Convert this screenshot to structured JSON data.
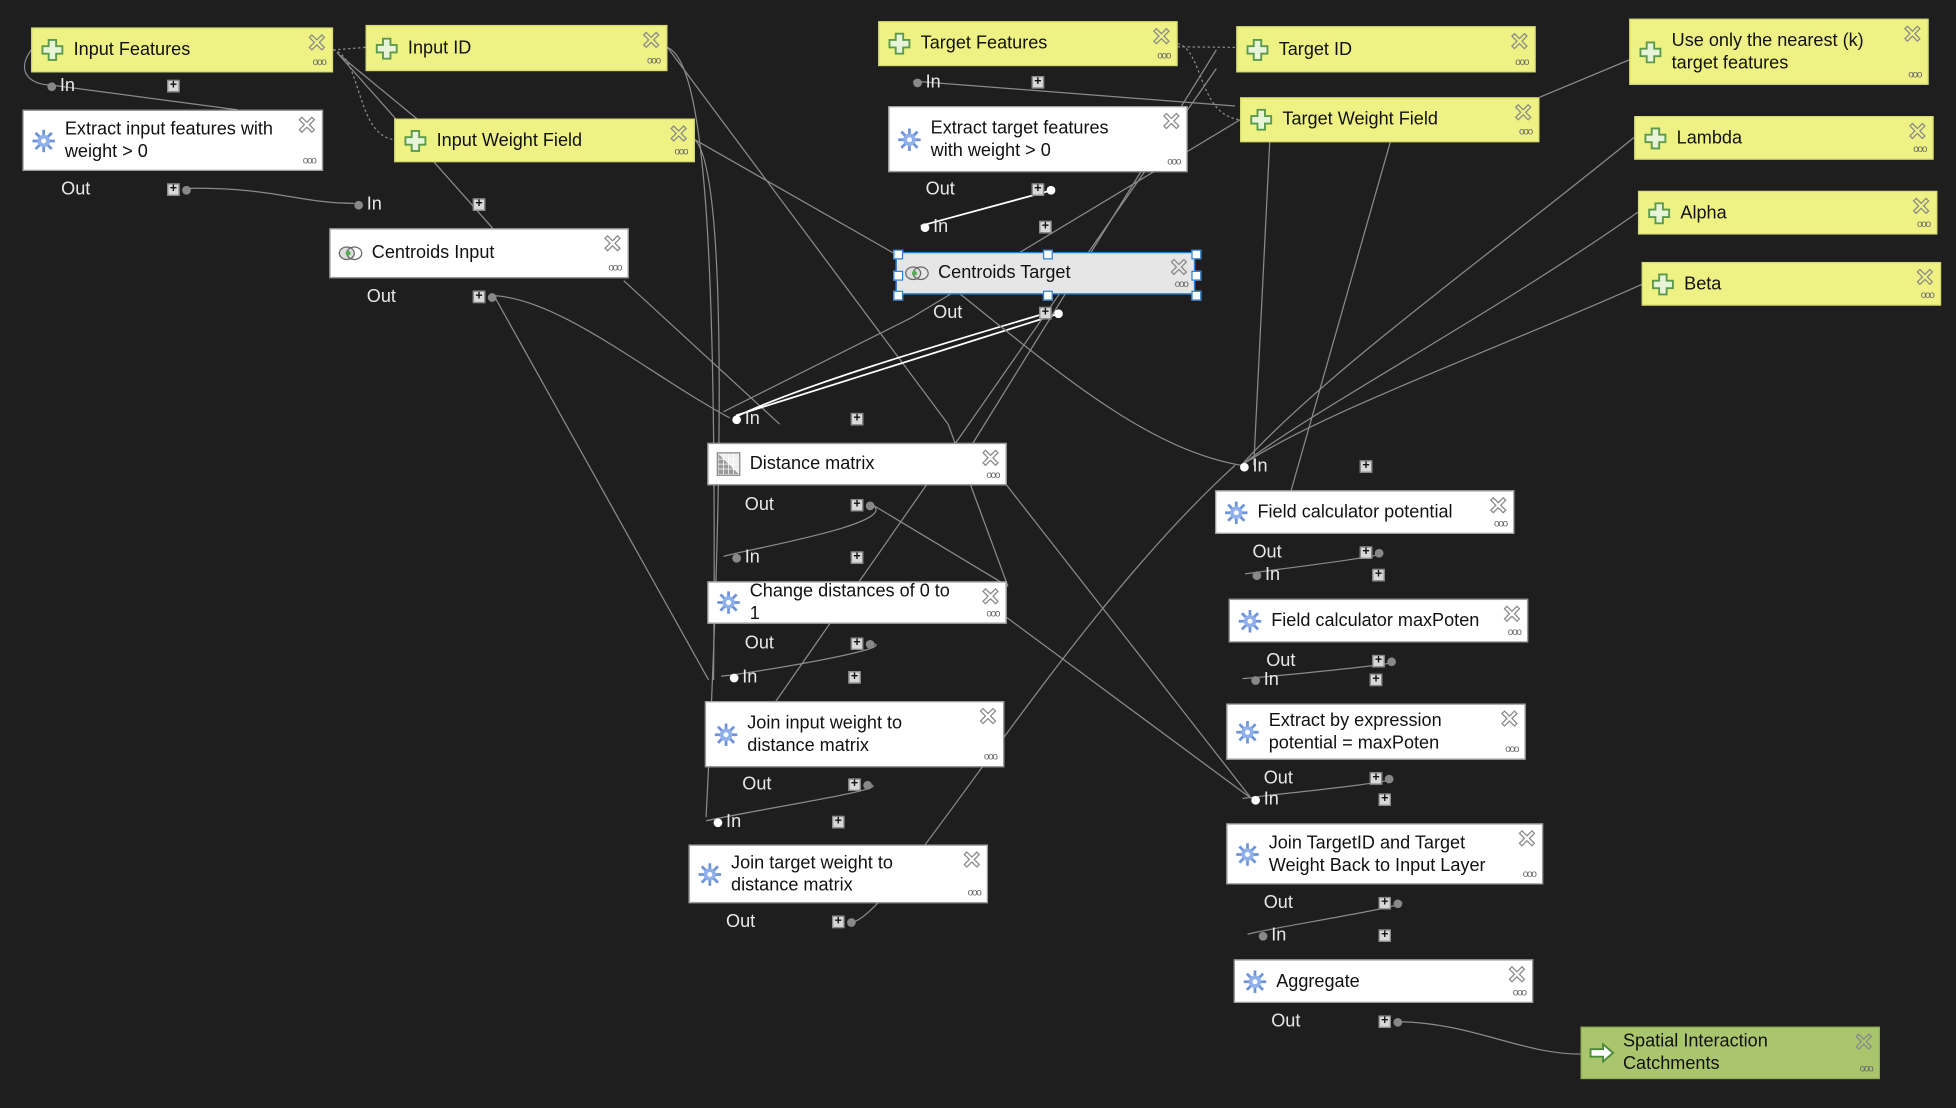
{
  "canvas": {
    "background": "#1e1e1e",
    "wire_color": "#8a8a8a"
  },
  "colors": {
    "parameter": "#eef284",
    "algorithm": "#ffffff",
    "output": "#a9c56e",
    "selection": "#2f7fd0"
  },
  "ports": {
    "in": "In",
    "out": "Out"
  },
  "nodes": [
    {
      "label": "Input Features",
      "type": "parameter",
      "icon": "plus-icon"
    },
    {
      "label": "Input ID",
      "type": "parameter",
      "icon": "plus-icon"
    },
    {
      "label": "Extract input features with weight > 0",
      "type": "algorithm",
      "icon": "gear-icon"
    },
    {
      "label": "Input Weight Field",
      "type": "parameter",
      "icon": "plus-icon"
    },
    {
      "label": "Centroids Input",
      "type": "algorithm",
      "icon": "centroid-icon"
    },
    {
      "label": "Target Features",
      "type": "parameter",
      "icon": "plus-icon"
    },
    {
      "label": "Target ID",
      "type": "parameter",
      "icon": "plus-icon"
    },
    {
      "label": "Extract target features with weight > 0",
      "type": "algorithm",
      "icon": "gear-icon"
    },
    {
      "label": "Target Weight Field",
      "type": "parameter",
      "icon": "plus-icon"
    },
    {
      "label": "Use only the nearest (k) target features",
      "type": "parameter",
      "icon": "plus-icon"
    },
    {
      "label": "Lambda",
      "type": "parameter",
      "icon": "plus-icon"
    },
    {
      "label": "Alpha",
      "type": "parameter",
      "icon": "plus-icon"
    },
    {
      "label": "Beta",
      "type": "parameter",
      "icon": "plus-icon"
    },
    {
      "label": "Centroids Target",
      "type": "algorithm",
      "icon": "centroid-icon",
      "selected": true
    },
    {
      "label": "Distance matrix",
      "type": "algorithm",
      "icon": "matrix-icon"
    },
    {
      "label": "Change distances of 0 to 1",
      "type": "algorithm",
      "icon": "gear-icon"
    },
    {
      "label": "Join input weight to distance matrix",
      "type": "algorithm",
      "icon": "gear-icon"
    },
    {
      "label": "Join target weight to distance matrix",
      "type": "algorithm",
      "icon": "gear-icon"
    },
    {
      "label": "Field calculator potential",
      "type": "algorithm",
      "icon": "gear-icon"
    },
    {
      "label": "Field calculator maxPoten",
      "type": "algorithm",
      "icon": "gear-icon"
    },
    {
      "label": "Extract by expression potential = maxPoten",
      "type": "algorithm",
      "icon": "gear-icon"
    },
    {
      "label": "Join TargetID and Target Weight Back to Input Layer",
      "type": "algorithm",
      "icon": "gear-icon"
    },
    {
      "label": "Aggregate",
      "type": "algorithm",
      "icon": "gear-icon"
    },
    {
      "label": "Spatial Interaction Catchments",
      "type": "output",
      "icon": "output-arrow-icon"
    }
  ]
}
